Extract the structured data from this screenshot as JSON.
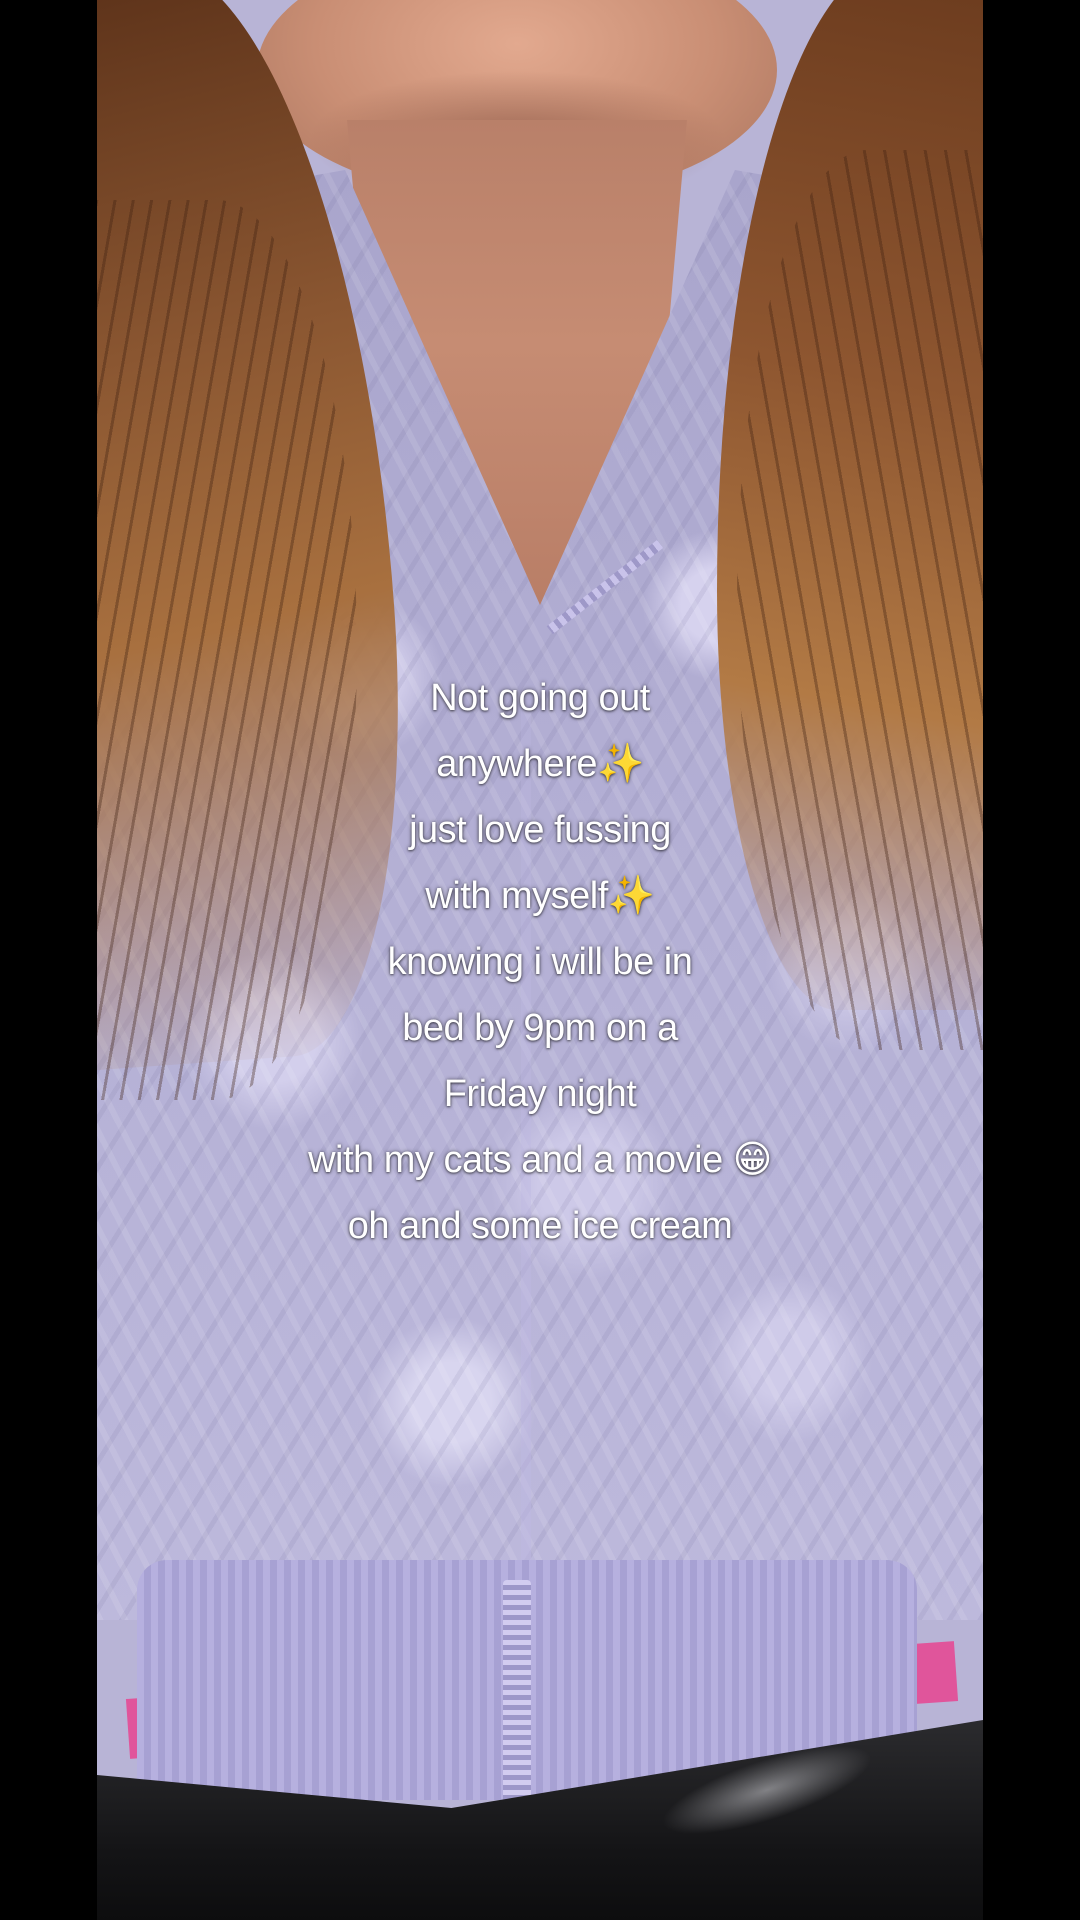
{
  "caption": {
    "lines": [
      "Not going out",
      "anywhere✨",
      "just love fussing",
      "with myself✨",
      "knowing i will be in",
      "bed by 9pm on a",
      "Friday night",
      "with my cats and a movie 😁",
      "oh and some ice cream"
    ]
  },
  "colors": {
    "background": "#000000",
    "sweater": "#b8b4d6",
    "caption_text": "#ffffff"
  }
}
